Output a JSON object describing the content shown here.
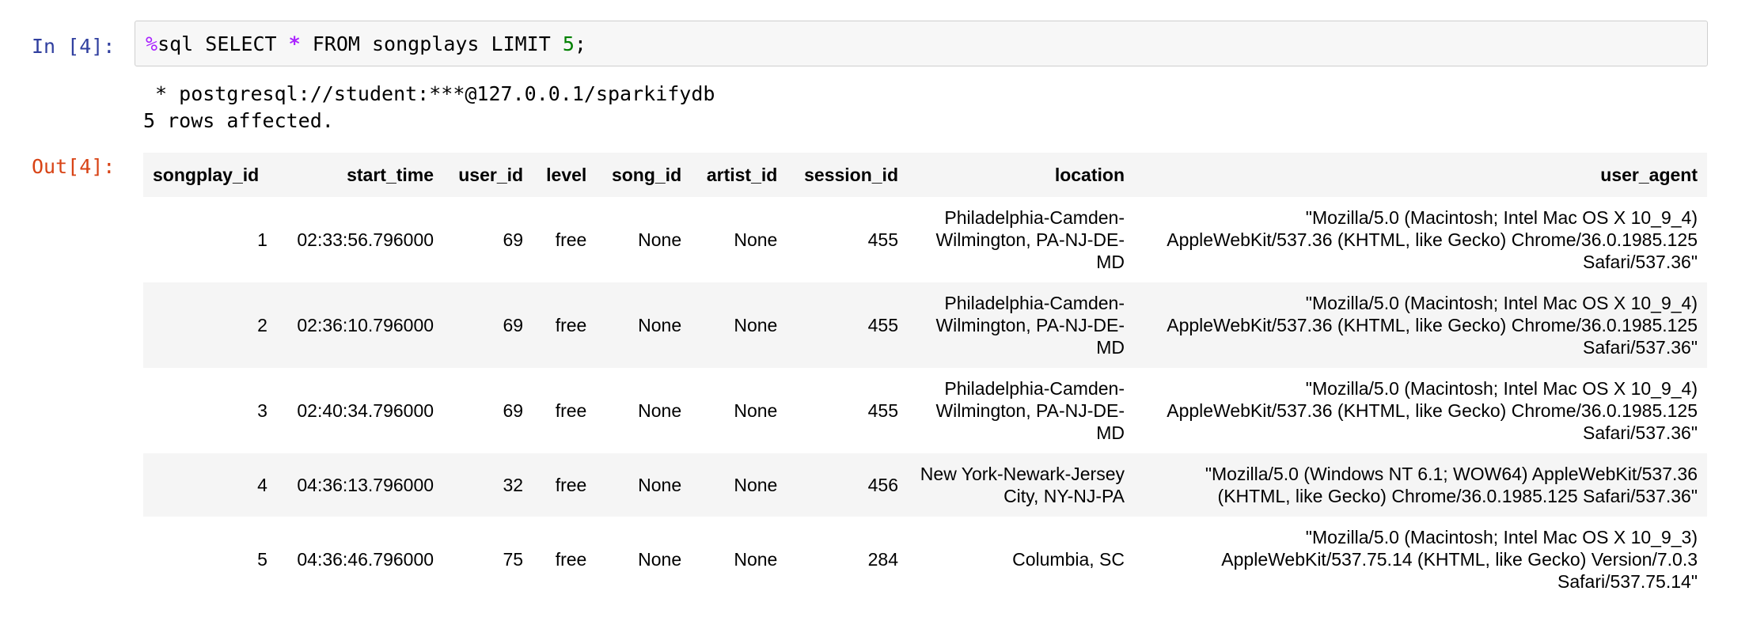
{
  "input_cell": {
    "prompt": "In [4]:",
    "code_magic": "%",
    "code_part1": "sql SELECT ",
    "code_star": "*",
    "code_part2": " FROM songplays LIMIT ",
    "code_number": "5",
    "code_end": ";"
  },
  "stream_output": {
    "line1": " * postgresql://student:***@127.0.0.1/sparkifydb",
    "line2": "5 rows affected."
  },
  "output_cell": {
    "prompt": "Out[4]:"
  },
  "table": {
    "headers": [
      "songplay_id",
      "start_time",
      "user_id",
      "level",
      "song_id",
      "artist_id",
      "session_id",
      "location",
      "user_agent"
    ],
    "rows": [
      [
        "1",
        "02:33:56.796000",
        "69",
        "free",
        "None",
        "None",
        "455",
        "Philadelphia-Camden-Wilmington, PA-NJ-DE-MD",
        "\"Mozilla/5.0 (Macintosh; Intel Mac OS X 10_9_4) AppleWebKit/537.36 (KHTML, like Gecko) Chrome/36.0.1985.125 Safari/537.36\""
      ],
      [
        "2",
        "02:36:10.796000",
        "69",
        "free",
        "None",
        "None",
        "455",
        "Philadelphia-Camden-Wilmington, PA-NJ-DE-MD",
        "\"Mozilla/5.0 (Macintosh; Intel Mac OS X 10_9_4) AppleWebKit/537.36 (KHTML, like Gecko) Chrome/36.0.1985.125 Safari/537.36\""
      ],
      [
        "3",
        "02:40:34.796000",
        "69",
        "free",
        "None",
        "None",
        "455",
        "Philadelphia-Camden-Wilmington, PA-NJ-DE-MD",
        "\"Mozilla/5.0 (Macintosh; Intel Mac OS X 10_9_4) AppleWebKit/537.36 (KHTML, like Gecko) Chrome/36.0.1985.125 Safari/537.36\""
      ],
      [
        "4",
        "04:36:13.796000",
        "32",
        "free",
        "None",
        "None",
        "456",
        "New York-Newark-Jersey City, NY-NJ-PA",
        "\"Mozilla/5.0 (Windows NT 6.1; WOW64) AppleWebKit/537.36 (KHTML, like Gecko) Chrome/36.0.1985.125 Safari/537.36\""
      ],
      [
        "5",
        "04:36:46.796000",
        "75",
        "free",
        "None",
        "None",
        "284",
        "Columbia, SC",
        "\"Mozilla/5.0 (Macintosh; Intel Mac OS X 10_9_3) AppleWebKit/537.75.14 (KHTML, like Gecko) Version/7.0.3 Safari/537.75.14\""
      ]
    ]
  },
  "colors": {
    "input_prompt": "#303f9f",
    "output_prompt": "#d84315",
    "magic_keyword": "#aa22ff",
    "number_literal": "#008000",
    "input_background": "#f7f7f7",
    "striped_row": "#f5f5f5"
  }
}
